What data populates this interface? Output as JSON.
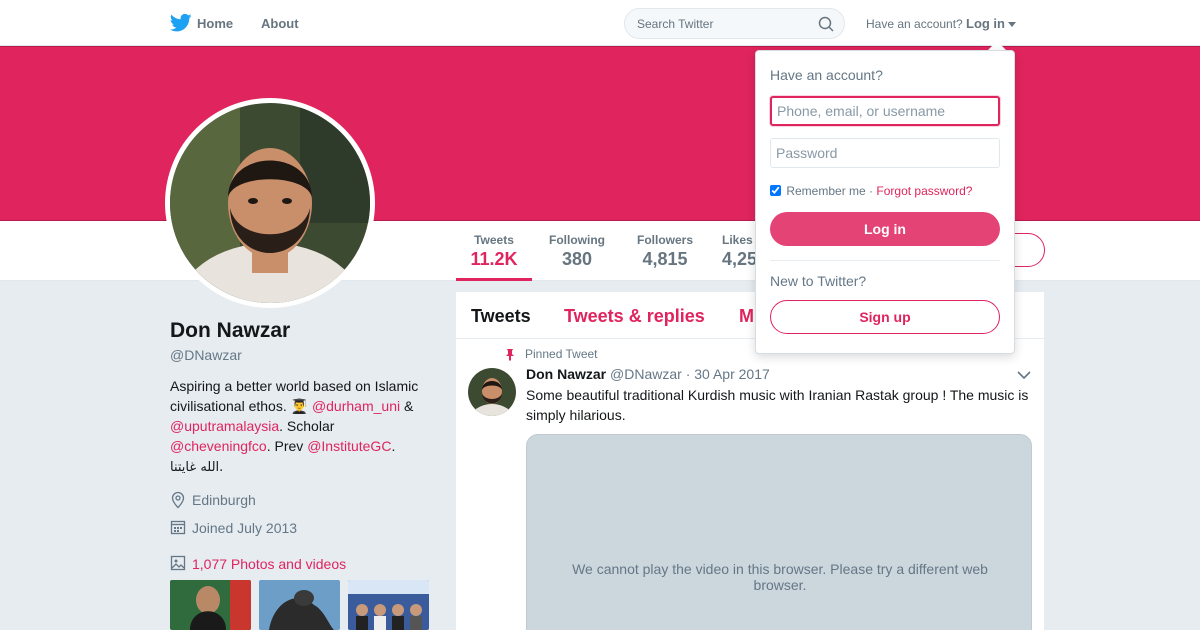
{
  "nav": {
    "home_label": "Home",
    "about_label": "About",
    "search_placeholder": "Search Twitter",
    "have_account": "Have an account?",
    "login_label": "Log in"
  },
  "colors": {
    "accent": "#e0245e",
    "text_secondary": "#657786",
    "background": "#e6ecf0"
  },
  "stats": {
    "tweets_label": "Tweets",
    "tweets_value": "11.2K",
    "following_label": "Following",
    "following_value": "380",
    "followers_label": "Followers",
    "followers_value": "4,815",
    "likes_label": "Likes",
    "likes_value": "4,25"
  },
  "profile": {
    "name": "Don Nawzar",
    "handle": "@DNawzar",
    "bio_part1": "Aspiring a better world based on Islamic civilisational ethos. 👨‍🎓",
    "mention1": "@durham_uni",
    "bio_part2": " & ",
    "mention2": "@uputramalaysia",
    "bio_part3": ". Scholar ",
    "mention3": "@cheveningfco",
    "bio_part4": ". Prev ",
    "mention4": "@InstituteGC",
    "bio_part5": ".",
    "bio_arabic": ".الله غايتنا",
    "location": "Edinburgh",
    "joined": "Joined July 2013",
    "photos_link": "1,077 Photos and videos"
  },
  "timeline": {
    "tabs": [
      "Tweets",
      "Tweets & replies",
      "M"
    ],
    "pinned_label": "Pinned Tweet",
    "tweet": {
      "name": "Don Nawzar",
      "handle": "@DNawzar",
      "separator": "·",
      "date": "30 Apr 2017",
      "text": "Some beautiful traditional Kurdish music with Iranian Rastak group ! The music is simply hilarious.",
      "video_message": "We cannot play the video in this browser. Please try a different web browser."
    }
  },
  "login_dropdown": {
    "title": "Have an account?",
    "username_placeholder": "Phone, email, or username",
    "password_placeholder": "Password",
    "remember_label": "Remember me",
    "separator": "·",
    "forgot_label": "Forgot password?",
    "login_button": "Log in",
    "new_label": "New to Twitter?",
    "signup_button": "Sign up"
  }
}
